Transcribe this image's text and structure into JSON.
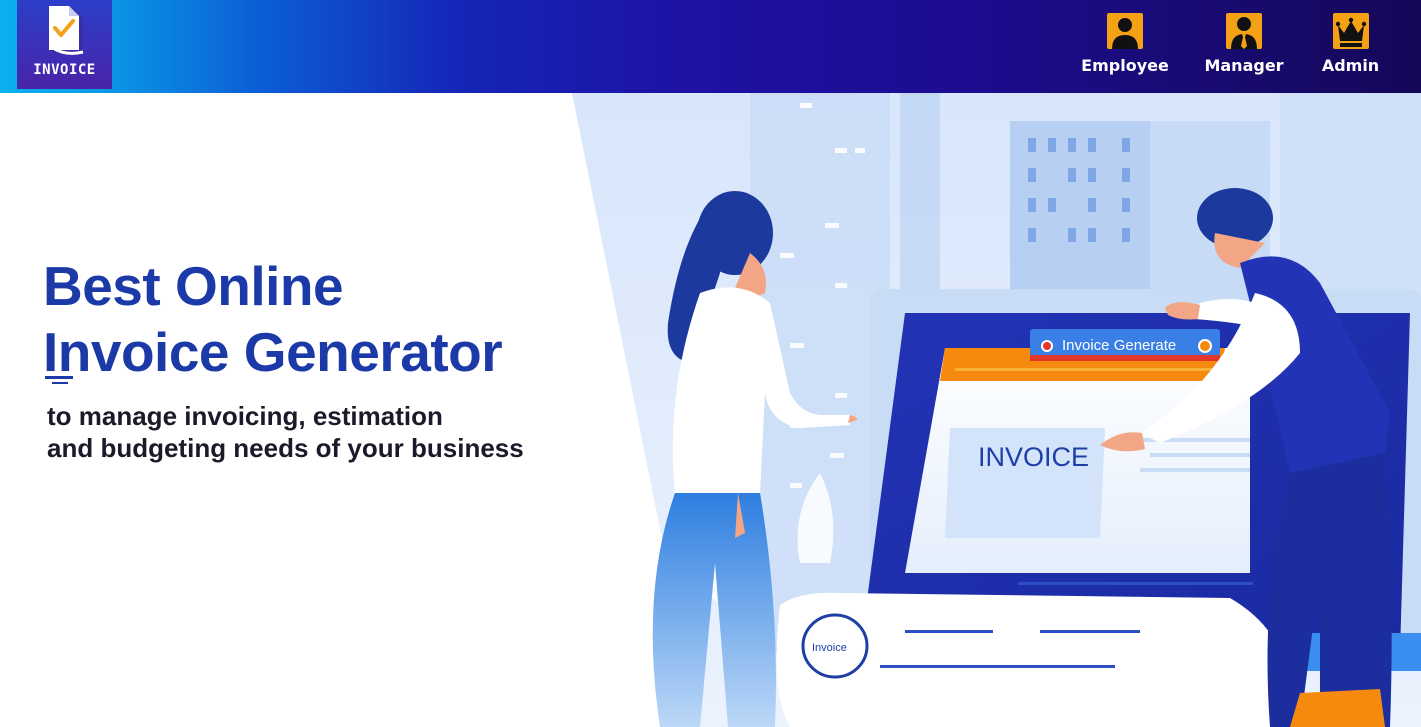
{
  "brand": {
    "logo_text": "INVOICE",
    "colors": {
      "accent": "#f4a115",
      "headline": "#1b3aa8",
      "header_start": "#0bb0ee",
      "header_end": "#140859"
    }
  },
  "nav": {
    "roles": [
      {
        "label": "Employee",
        "icon": "person-icon"
      },
      {
        "label": "Manager",
        "icon": "manager-tie-icon"
      },
      {
        "label": "Admin",
        "icon": "crown-icon"
      }
    ]
  },
  "hero": {
    "headline_line1": "Best Online",
    "headline_line2": "Invoice Generator",
    "subline_line1": "to manage invoicing, estimation",
    "subline_line2": "and budgeting needs of your business",
    "illustration": {
      "banner_label": "Invoice Generate",
      "document_title": "INVOICE",
      "stamp_label": "Invoice"
    }
  }
}
